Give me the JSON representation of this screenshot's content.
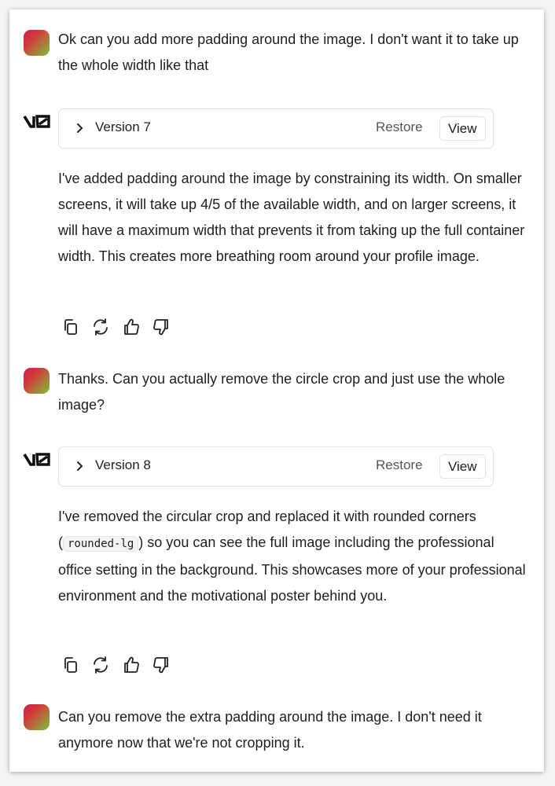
{
  "messages": [
    {
      "role": "user",
      "text": "Ok can you add more padding around the image. I don't want it to take up the whole width like that"
    },
    {
      "role": "assistant",
      "version_label": "Version 7",
      "restore_label": "Restore",
      "view_label": "View",
      "text": "I've added padding around the image by constraining its width. On smaller screens, it will take up 4/5 of the available width, and on larger screens, it will have a maximum width that prevents it from taking up the full container width. This creates more breathing room around your profile image."
    },
    {
      "role": "user",
      "text": "Thanks. Can you actually remove the circle crop and just use the whole image?"
    },
    {
      "role": "assistant",
      "version_label": "Version 8",
      "restore_label": "Restore",
      "view_label": "View",
      "text_before": "I've removed the circular crop and replaced it with rounded corners (",
      "code": "rounded-lg",
      "text_after": ") so you can see the full image including the professional office setting in the background. This showcases more of your professional environment and the motivational poster behind you."
    },
    {
      "role": "user",
      "text": "Can you remove the extra padding around the image. I don't need it anymore now that we're not cropping it."
    }
  ],
  "icons": {
    "logo": "v0-logo",
    "chevron": "chevron-right-icon",
    "actions": [
      "copy-icon",
      "refresh-icon",
      "thumbs-up-icon",
      "thumbs-down-icon"
    ]
  },
  "colors": {
    "avatar_gradient": [
      "#c61d4e",
      "#d23d3a",
      "#7cc23c"
    ],
    "text": "#202020",
    "border": "#e3e3e3"
  }
}
